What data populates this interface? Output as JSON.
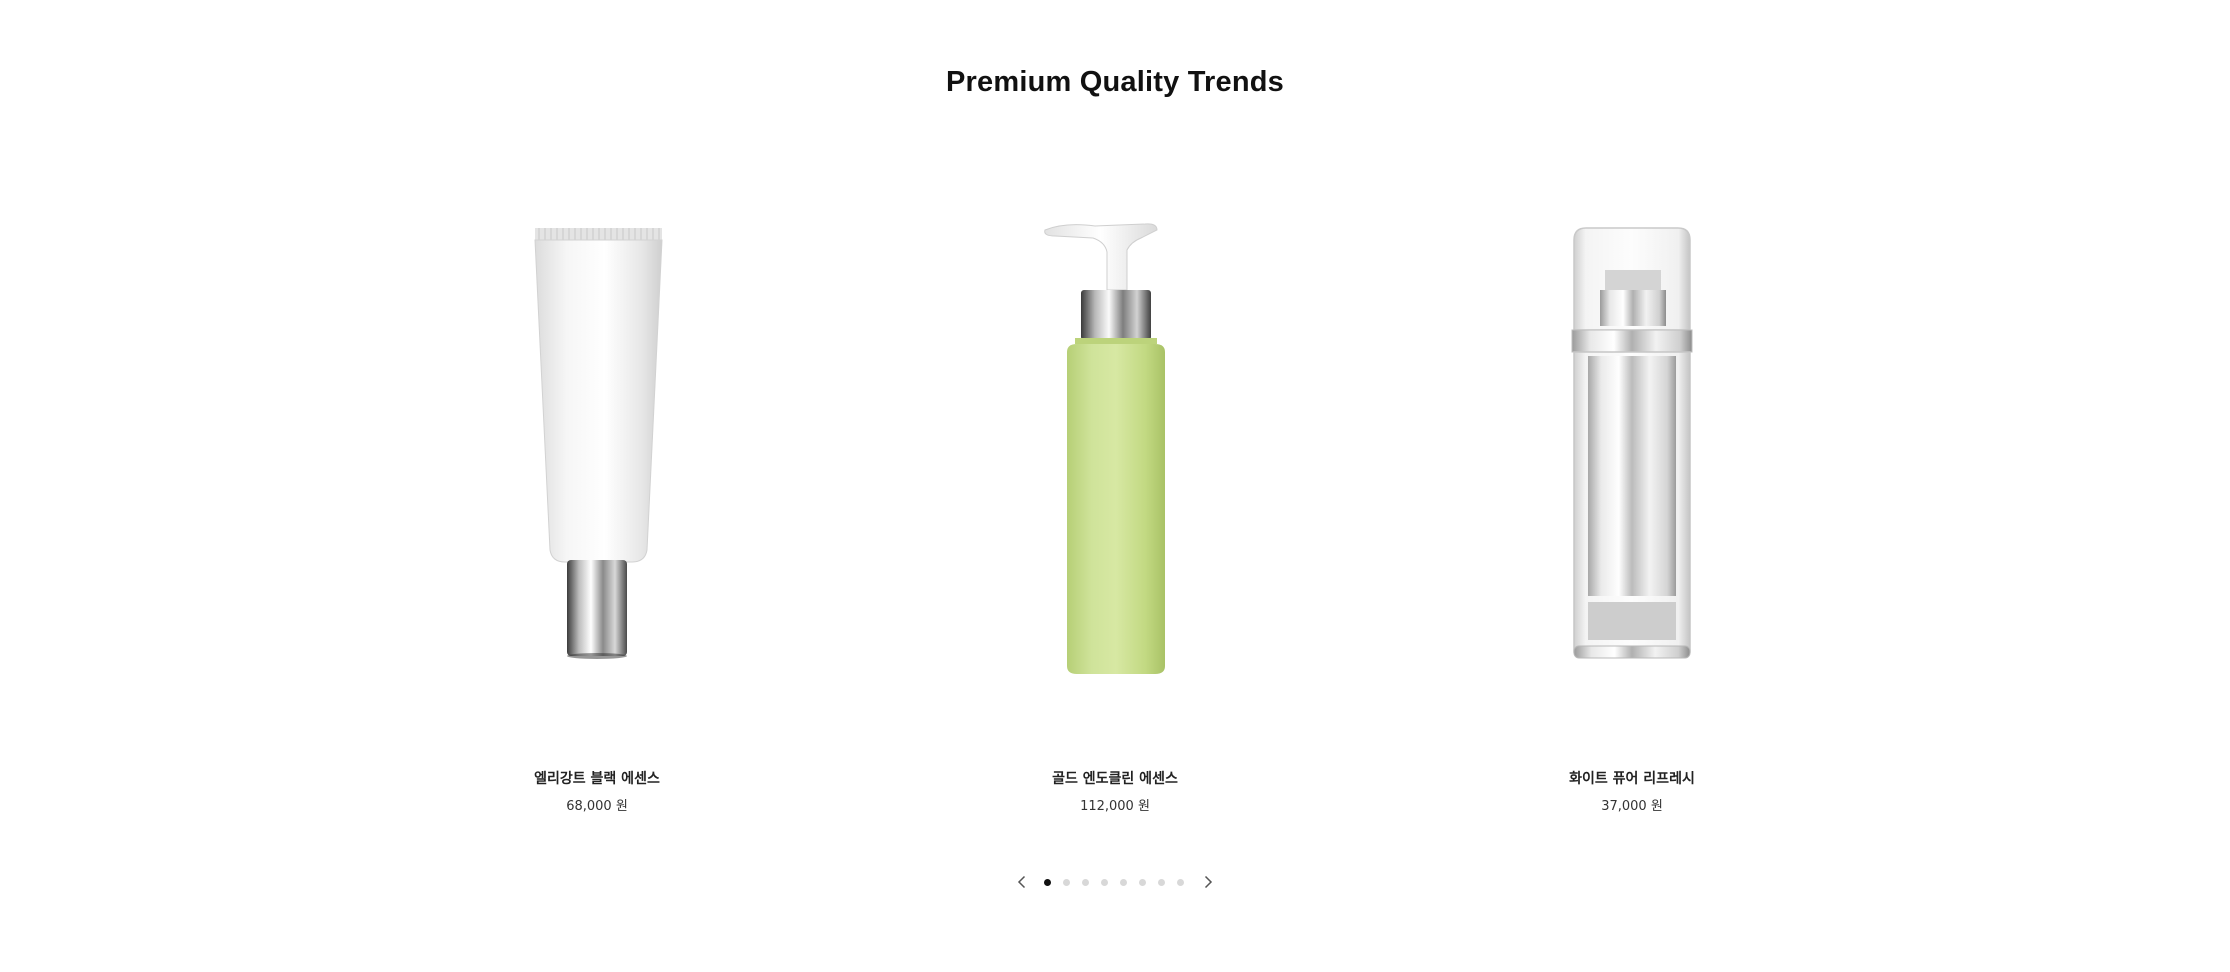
{
  "section": {
    "title": "Premium Quality Trends"
  },
  "products": [
    {
      "name": "엘리강트 블랙 에센스",
      "price": "68,000 원",
      "image": "white-tube-bottle"
    },
    {
      "name": "골드 엔도클린 에센스",
      "price": "112,000 원",
      "image": "green-pump-bottle"
    },
    {
      "name": "화이트 퓨어 리프레시",
      "price": "37,000 원",
      "image": "clear-airless-bottle"
    }
  ],
  "pagination": {
    "total_pages": 8,
    "current_page": 1,
    "prev_icon": "chevron-left-icon",
    "next_icon": "chevron-right-icon"
  },
  "colors": {
    "active_dot": "#111111",
    "inactive_dot": "#d8d8d8",
    "green_bottle": "#c5dc86"
  }
}
